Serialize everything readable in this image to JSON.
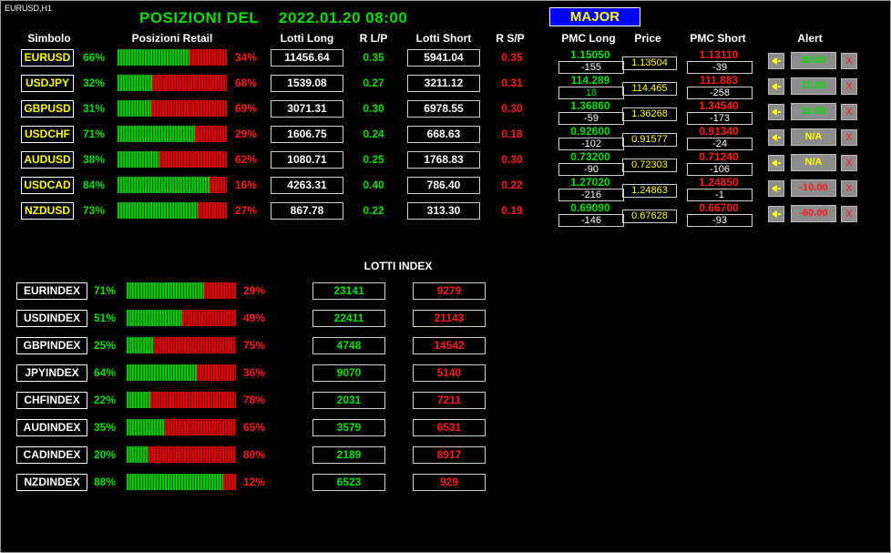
{
  "window_title": "EURUSD,H1",
  "header": {
    "title_left": "POSIZIONI  DEL",
    "title_date": "2022.01.20 08:00",
    "major_button": "MAJOR"
  },
  "columns": {
    "simbolo": "Simbolo",
    "posizioni_retail": "Posizioni Retail",
    "lotti_long": "Lotti Long",
    "r_lp": "R L/P",
    "lotti_short": "Lotti Short",
    "r_sp": "R S/P",
    "pmc_long": "PMC Long",
    "price": "Price",
    "pmc_short": "PMC Short",
    "alert": "Alert"
  },
  "colors": {
    "green": "#00e000",
    "red": "#ff1a1a",
    "yellow": "#ffff00",
    "blue": "#0000ff"
  },
  "pairs": [
    {
      "symbol": "EURUSD",
      "long_pct": "66%",
      "short_pct": "34%",
      "long_frac": 0.66,
      "lotti_long": "11456.64",
      "r_lp": "0.35",
      "lotti_short": "5941.04",
      "r_sp": "0.35",
      "pmc_long": "1.15050",
      "pmc_long_diff": "-155",
      "price": "1.13504",
      "pmc_short": "1.13110",
      "pmc_short_diff": "-39",
      "alert": "35.00",
      "alert_color": "green",
      "alert_x": "X"
    },
    {
      "symbol": "USDJPY",
      "long_pct": "32%",
      "short_pct": "68%",
      "long_frac": 0.32,
      "lotti_long": "1539.08",
      "r_lp": "0.27",
      "lotti_short": "3211.12",
      "r_sp": "0.31",
      "pmc_long": "114.289",
      "pmc_long_diff": "18",
      "price": "114.465",
      "pmc_short": "111.883",
      "pmc_short_diff": "-258",
      "alert": "70.00",
      "alert_color": "green",
      "alert_x": "X"
    },
    {
      "symbol": "GBPUSD",
      "long_pct": "31%",
      "short_pct": "69%",
      "long_frac": 0.31,
      "lotti_long": "3071.31",
      "r_lp": "0.30",
      "lotti_short": "6978.55",
      "r_sp": "0.30",
      "pmc_long": "1.36860",
      "pmc_long_diff": "-59",
      "price": "1.36268",
      "pmc_short": "1.34540",
      "pmc_short_diff": "-173",
      "alert": "15.00",
      "alert_color": "green",
      "alert_x": "X"
    },
    {
      "symbol": "USDCHF",
      "long_pct": "71%",
      "short_pct": "29%",
      "long_frac": 0.71,
      "lotti_long": "1606.75",
      "r_lp": "0.24",
      "lotti_short": "668.63",
      "r_sp": "0.18",
      "pmc_long": "0.92600",
      "pmc_long_diff": "-102",
      "price": "0.91577",
      "pmc_short": "0.91340",
      "pmc_short_diff": "-24",
      "alert": "N/A",
      "alert_color": "yellow",
      "alert_x": "X"
    },
    {
      "symbol": "AUDUSD",
      "long_pct": "38%",
      "short_pct": "62%",
      "long_frac": 0.38,
      "lotti_long": "1080.71",
      "r_lp": "0.25",
      "lotti_short": "1768.83",
      "r_sp": "0.30",
      "pmc_long": "0.73200",
      "pmc_long_diff": "-90",
      "price": "0.72303",
      "pmc_short": "0.71240",
      "pmc_short_diff": "-106",
      "alert": "N/A",
      "alert_color": "yellow",
      "alert_x": "X"
    },
    {
      "symbol": "USDCAD",
      "long_pct": "84%",
      "short_pct": "16%",
      "long_frac": 0.84,
      "lotti_long": "4263.31",
      "r_lp": "0.40",
      "lotti_short": "786.40",
      "r_sp": "0.22",
      "pmc_long": "1.27020",
      "pmc_long_diff": "-216",
      "price": "1.24863",
      "pmc_short": "1.24850",
      "pmc_short_diff": "-1",
      "alert": "-10.00",
      "alert_color": "red",
      "alert_x": "X"
    },
    {
      "symbol": "NZDUSD",
      "long_pct": "73%",
      "short_pct": "27%",
      "long_frac": 0.73,
      "lotti_long": "867.78",
      "r_lp": "0.22",
      "lotti_short": "313.30",
      "r_sp": "0.19",
      "pmc_long": "0.69090",
      "pmc_long_diff": "-146",
      "price": "0.67628",
      "pmc_short": "0.66700",
      "pmc_short_diff": "-93",
      "alert": "-60.00",
      "alert_color": "red",
      "alert_x": "X"
    }
  ],
  "index_section": {
    "title": "LOTTI INDEX",
    "rows": [
      {
        "symbol": "EURINDEX",
        "long_pct": "71%",
        "short_pct": "29%",
        "long_frac": 0.71,
        "long": "23141",
        "short": "9279"
      },
      {
        "symbol": "USDINDEX",
        "long_pct": "51%",
        "short_pct": "49%",
        "long_frac": 0.51,
        "long": "22411",
        "short": "21143"
      },
      {
        "symbol": "GBPINDEX",
        "long_pct": "25%",
        "short_pct": "75%",
        "long_frac": 0.25,
        "long": "4748",
        "short": "14542"
      },
      {
        "symbol": "JPYINDEX",
        "long_pct": "64%",
        "short_pct": "36%",
        "long_frac": 0.64,
        "long": "9070",
        "short": "5140"
      },
      {
        "symbol": "CHFINDEX",
        "long_pct": "22%",
        "short_pct": "78%",
        "long_frac": 0.22,
        "long": "2031",
        "short": "7211"
      },
      {
        "symbol": "AUDINDEX",
        "long_pct": "35%",
        "short_pct": "65%",
        "long_frac": 0.35,
        "long": "3579",
        "short": "6531"
      },
      {
        "symbol": "CADINDEX",
        "long_pct": "20%",
        "short_pct": "80%",
        "long_frac": 0.2,
        "long": "2189",
        "short": "8917"
      },
      {
        "symbol": "NZDINDEX",
        "long_pct": "88%",
        "short_pct": "12%",
        "long_frac": 0.88,
        "long": "6523",
        "short": "929"
      }
    ]
  },
  "icons": {
    "alert_bell": "bell-icon",
    "alert_remove": "close-icon"
  }
}
